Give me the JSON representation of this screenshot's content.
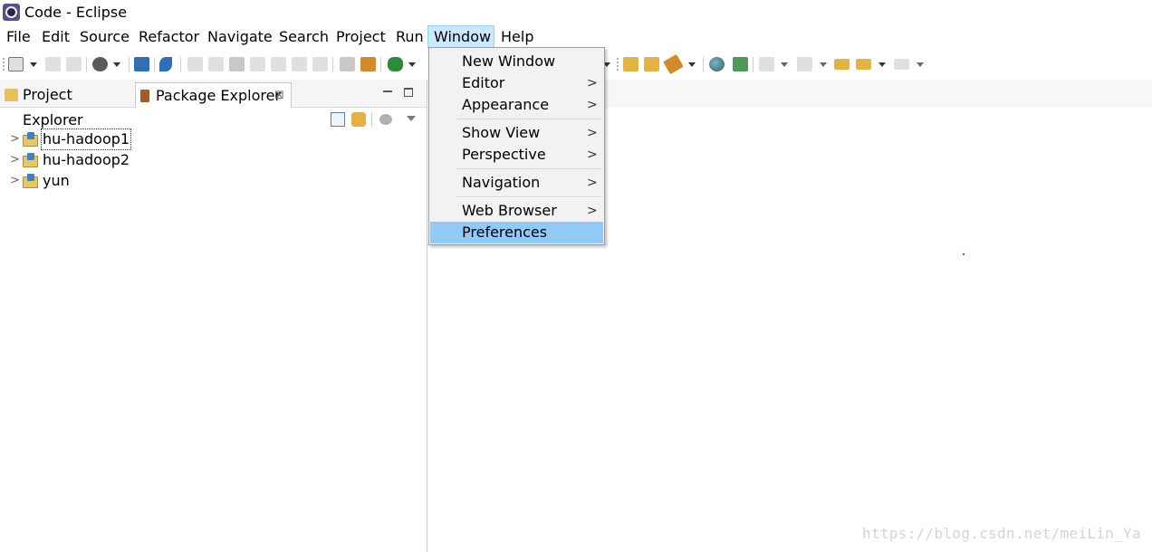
{
  "window": {
    "title": "Code - Eclipse",
    "icon": "eclipse-icon"
  },
  "menubar": {
    "items": [
      "File",
      "Edit",
      "Source",
      "Refactor",
      "Navigate",
      "Search",
      "Project",
      "Run",
      "Window",
      "Help"
    ],
    "active": "Window"
  },
  "window_menu": {
    "items": [
      {
        "label": "New Window",
        "submenu": false
      },
      {
        "label": "Editor",
        "submenu": true
      },
      {
        "label": "Appearance",
        "submenu": true
      },
      {
        "label": "Show View",
        "submenu": true
      },
      {
        "label": "Perspective",
        "submenu": true
      },
      {
        "label": "Navigation",
        "submenu": true
      },
      {
        "label": "Web Browser",
        "submenu": true
      },
      {
        "label": "Preferences",
        "submenu": false,
        "highlighted": true
      }
    ],
    "submenu_glyph": ">",
    "highlight_color": "#91c9f7"
  },
  "left_view": {
    "tabs": [
      {
        "label": "Project Explorer",
        "icon": "project-explorer-icon",
        "active": false
      },
      {
        "label": "Package Explorer",
        "icon": "package-explorer-icon",
        "active": true,
        "close": "⊠"
      }
    ],
    "tree": [
      {
        "label": "hu-hadoop1",
        "icon": "java-project-icon",
        "selected": true
      },
      {
        "label": "hu-hadoop2",
        "icon": "java-project-icon",
        "selected": false
      },
      {
        "label": "yun",
        "icon": "java-project-icon",
        "selected": false
      }
    ],
    "expand_glyph": ">"
  },
  "watermark": "https://blog.csdn.net/meiLin_Ya",
  "colors": {
    "menu_active_bg": "#cce8ff",
    "menu_active_border": "#99d1ff",
    "menu_bg": "#f2f2f2"
  }
}
